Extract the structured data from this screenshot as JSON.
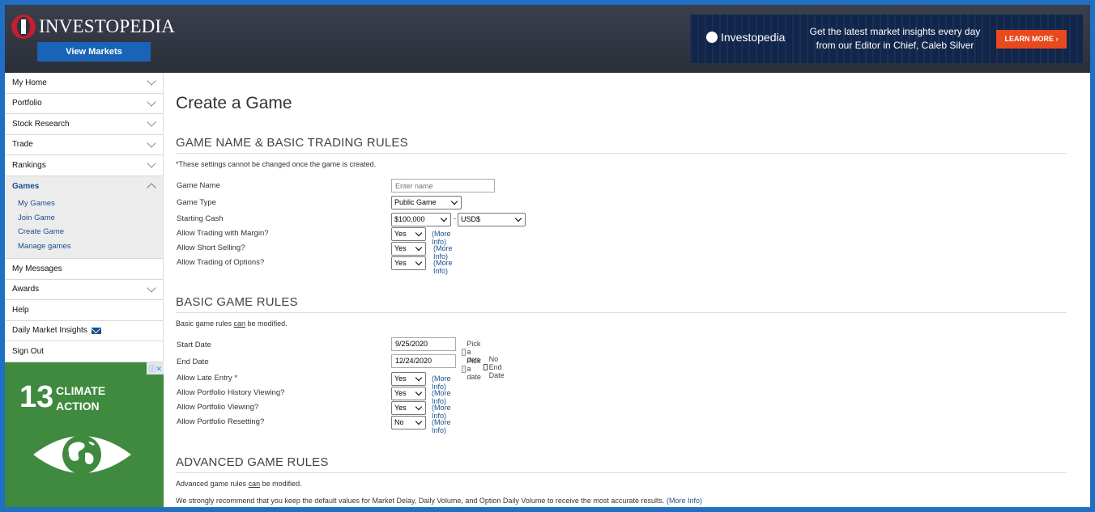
{
  "header": {
    "logo_text": "INVESTOPEDIA",
    "view_markets": "View Markets",
    "ad": {
      "brand": "Investopedia",
      "copy_line1": "Get the latest market insights every day",
      "copy_line2": "from our Editor in Chief, Caleb Silver",
      "cta": "LEARN MORE ›"
    }
  },
  "sidebar": {
    "items": [
      {
        "label": "My Home"
      },
      {
        "label": "Portfolio"
      },
      {
        "label": "Stock Research"
      },
      {
        "label": "Trade"
      },
      {
        "label": "Rankings"
      }
    ],
    "games": {
      "label": "Games",
      "subitems": [
        "My Games",
        "Join Game",
        "Create Game",
        "Manage games"
      ]
    },
    "items2": [
      {
        "label": "My Messages"
      },
      {
        "label": "Awards"
      },
      {
        "label": "Help"
      },
      {
        "label": "Daily Market Insights"
      },
      {
        "label": "Sign Out"
      }
    ],
    "ad": {
      "close": "ⓘ✕",
      "number": "13",
      "title_line1": "CLIMATE",
      "title_line2": "ACTION"
    }
  },
  "main": {
    "title": "Create a Game",
    "section1": {
      "heading": "GAME NAME & BASIC TRADING RULES",
      "note": "*These settings cannot be changed once the game is created.",
      "game_name_label": "Game Name",
      "game_name_placeholder": "Enter name",
      "game_type_label": "Game Type",
      "game_type_value": "Public Game",
      "starting_cash_label": "Starting Cash",
      "starting_cash_value": "$100,000",
      "currency_value": "USD$",
      "margin_label": "Allow Trading with Margin?",
      "margin_value": "Yes",
      "short_label": "Allow Short Selling?",
      "short_value": "Yes",
      "options_label": "Allow Trading of Options?",
      "options_value": "Yes",
      "more_info": "(More Info)"
    },
    "section2": {
      "heading": "BASIC GAME RULES",
      "note_prefix": "Basic game rules ",
      "note_can": "can",
      "note_suffix": " be modified.",
      "start_label": "Start Date",
      "start_value": "9/25/2020",
      "end_label": "End Date",
      "end_value": "12/24/2020",
      "pick_date": "Pick a date",
      "no_end_date": "No End Date",
      "late_label": "Allow Late Entry *",
      "late_value": "Yes",
      "history_label": "Allow Portfolio History Viewing?",
      "history_value": "Yes",
      "viewing_label": "Allow Portfolio Viewing?",
      "viewing_value": "Yes",
      "reset_label": "Allow Portfolio Resetting?",
      "reset_value": "No",
      "more_info": "(More Info)"
    },
    "section3": {
      "heading": "ADVANCED GAME RULES",
      "note_prefix": "Advanced game rules ",
      "note_can": "can",
      "note_suffix": " be modified.",
      "recommend": "We strongly recommend that you keep the default values for Market Delay, Daily Volume, and Option Daily Volume to receive the most accurate results.",
      "more_info": "(More Info)"
    }
  }
}
